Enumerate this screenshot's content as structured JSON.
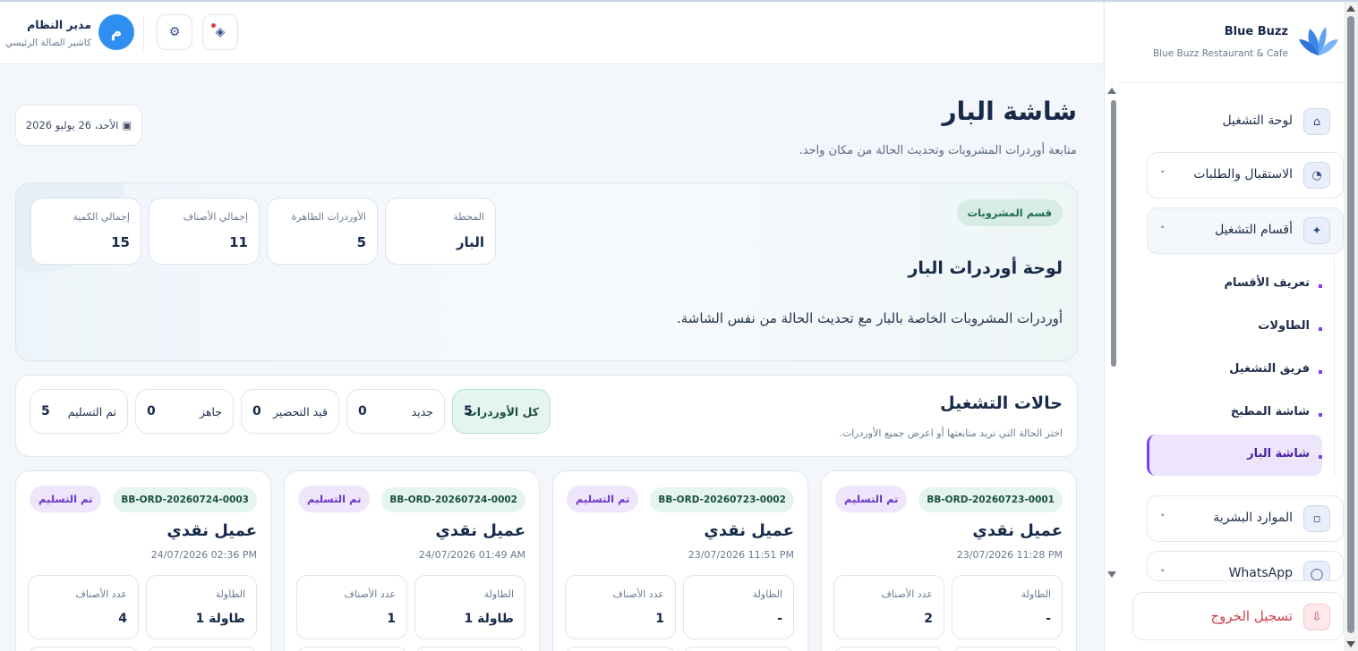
{
  "brand": {
    "name": "Blue Buzz",
    "subtitle": "Blue Buzz Restaurant & Cafe"
  },
  "header": {
    "user_name": "مدير النظام",
    "user_role": "كاشير الصالة الرئيسي",
    "avatar_initial": "م"
  },
  "sidebar": {
    "items": [
      {
        "label": "لوحة التشغيل",
        "icon": "home-icon"
      },
      {
        "label": "الاستقبال والطلبات",
        "icon": "pie-icon",
        "chevron": "˅"
      },
      {
        "label": "أقسام التشغيل",
        "icon": "sparkle-icon",
        "chevron": "˄"
      },
      {
        "label": "الموارد البشرية",
        "icon": "hr-icon",
        "chevron": "˅"
      },
      {
        "label": "WhatsApp",
        "icon": "whatsapp-icon",
        "chevron": "˅"
      }
    ],
    "subitems": [
      {
        "label": "تعريف الأقسام"
      },
      {
        "label": "الطاولات"
      },
      {
        "label": "فريق التشغيل"
      },
      {
        "label": "شاشة المطبخ"
      },
      {
        "label": "شاشة البار",
        "active": true
      }
    ],
    "logout_label": "تسجيل الخروج"
  },
  "page": {
    "title": "شاشة البار",
    "subtitle": "متابعة أوردرات المشروبات وتحديث الحالة من مكان واحد.",
    "date": "الأحد، 26 يوليو 2026"
  },
  "hero": {
    "badge": "قسم المشروبات",
    "title": "لوحة أوردرات البار",
    "description": "أوردرات المشروبات الخاصة بالبار مع تحديث الحالة من نفس الشاشة.",
    "stats": [
      {
        "label": "المحطة",
        "value": "البار"
      },
      {
        "label": "الأوردرات الظاهرة",
        "value": "5"
      },
      {
        "label": "إجمالي الأصناف",
        "value": "11"
      },
      {
        "label": "إجمالي الكمية",
        "value": "15"
      }
    ]
  },
  "status": {
    "title": "حالات التشغيل",
    "subtitle": "اختر الحالة التي تريد متابعتها أو اعرض جميع الأوردرات.",
    "filters": [
      {
        "label": "كل الأوردرات",
        "count": "5",
        "active": true
      },
      {
        "label": "جديد",
        "count": "0"
      },
      {
        "label": "قيد التحضير",
        "count": "0"
      },
      {
        "label": "جاهز",
        "count": "0"
      },
      {
        "label": "تم التسليم",
        "count": "5"
      }
    ]
  },
  "orders": [
    {
      "id": "BB-ORD-20260723-0001",
      "status": "تم التسليم",
      "customer": "عميل نقدي",
      "time": "23/07/2026 11:28 PM",
      "table_label": "الطاولة",
      "table": "-",
      "items_label": "عدد الأصناف",
      "items": "2"
    },
    {
      "id": "BB-ORD-20260723-0002",
      "status": "تم التسليم",
      "customer": "عميل نقدي",
      "time": "23/07/2026 11:51 PM",
      "table_label": "الطاولة",
      "table": "-",
      "items_label": "عدد الأصناف",
      "items": "1"
    },
    {
      "id": "BB-ORD-20260724-0002",
      "status": "تم التسليم",
      "customer": "عميل نقدي",
      "time": "24/07/2026 01:49 AM",
      "table_label": "الطاولة",
      "table": "طاولة 1",
      "items_label": "عدد الأصناف",
      "items": "1"
    },
    {
      "id": "BB-ORD-20260724-0003",
      "status": "تم التسليم",
      "customer": "عميل نقدي",
      "time": "24/07/2026 02:36 PM",
      "table_label": "الطاولة",
      "table": "طاولة 1",
      "items_label": "عدد الأصناف",
      "items": "4"
    }
  ],
  "colors": {
    "accent": "#7b3ff2",
    "primary": "#2f8ff0",
    "success_bg": "#e4f5ef",
    "danger": "#d33b4a"
  }
}
